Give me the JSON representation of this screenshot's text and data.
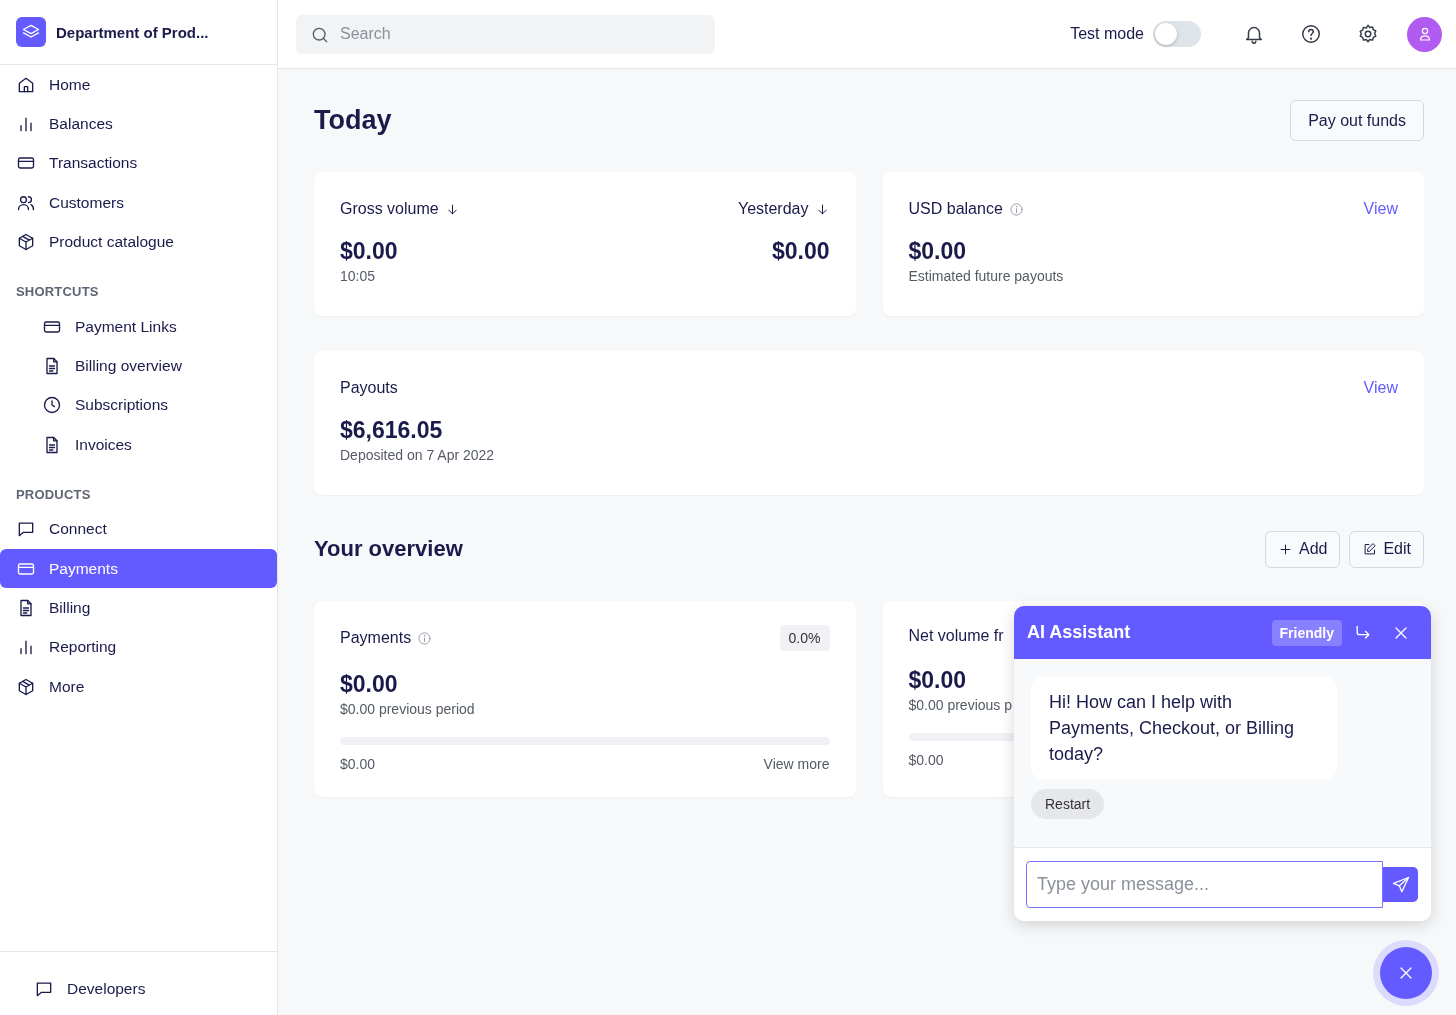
{
  "sidebar": {
    "account": "Department of Prod...",
    "items": [
      {
        "label": "Home",
        "selected": false
      },
      {
        "label": "Balances",
        "selected": false
      },
      {
        "label": "Transactions",
        "selected": false
      },
      {
        "label": "Customers",
        "selected": false
      },
      {
        "label": "Product catalogue",
        "selected": false
      }
    ],
    "sections": [
      {
        "title": "SHORTCUTS",
        "items": [
          {
            "label": "Payment Links",
            "selected": false
          },
          {
            "label": "Billing overview",
            "selected": false
          },
          {
            "label": "Subscriptions",
            "selected": false
          },
          {
            "label": "Invoices",
            "selected": false
          }
        ]
      },
      {
        "title": "PRODUCTS",
        "items": [
          {
            "label": "Connect",
            "selected": false
          },
          {
            "label": "Payments",
            "selected": true
          },
          {
            "label": "Billing",
            "selected": false
          },
          {
            "label": "Reporting",
            "selected": false
          },
          {
            "label": "More",
            "selected": false
          }
        ]
      }
    ],
    "footer": {
      "label": "Developers"
    }
  },
  "topbar": {
    "search": {
      "placeholder": "Search"
    },
    "test_mode": {
      "label": "Test mode",
      "on": false
    }
  },
  "today": {
    "title": "Today",
    "action": "Pay out funds",
    "gross": {
      "label": "Gross volume",
      "value": "$0.00",
      "time": "10:05",
      "compare_label": "Yesterday",
      "compare_value": "$0.00"
    },
    "balance": {
      "label": "USD balance",
      "link": "View",
      "value": "$0.00",
      "note": "Estimated future payouts"
    },
    "payouts": {
      "label": "Payouts",
      "link": "View",
      "value": "$6,616.05",
      "note": "Deposited on 7 Apr 2022"
    }
  },
  "overview": {
    "title": "Your overview",
    "add": "Add",
    "edit": "Edit",
    "cards": [
      {
        "title": "Payments",
        "info": true,
        "badge": "0.0%",
        "value": "$0.00",
        "previous": "$0.00 previous period",
        "level": 0,
        "footer": "$0.00",
        "link": "View more"
      },
      {
        "title": "Net volume fr",
        "info": false,
        "value": "$0.00",
        "previous": "$0.00 previous p",
        "level": 0,
        "footer": "$0.00"
      }
    ]
  },
  "assistant": {
    "title": "AI Assistant",
    "tone": "Friendly",
    "message": "Hi! How can I help with Payments, Checkout, or Billing today?",
    "restart": "Restart",
    "input": {
      "placeholder": "Type your message..."
    }
  }
}
